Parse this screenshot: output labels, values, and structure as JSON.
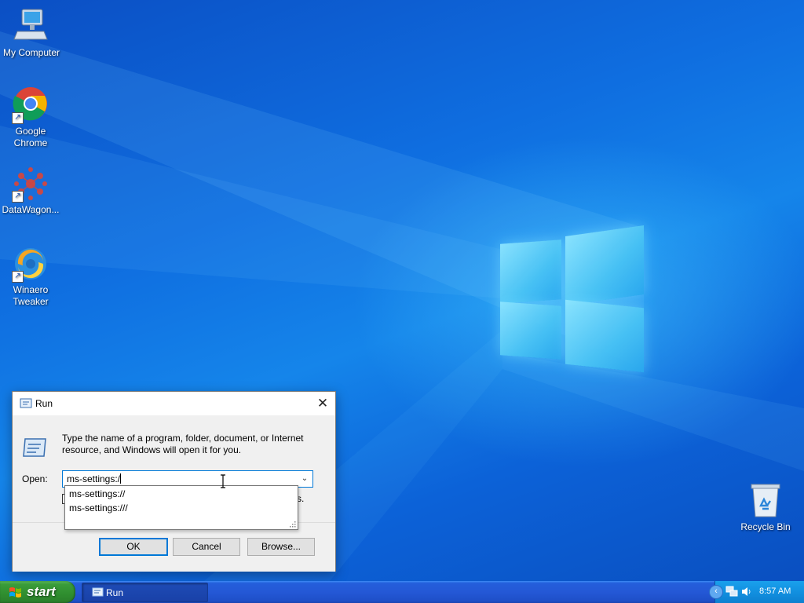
{
  "desktop": {
    "icons": [
      {
        "label": "My Computer",
        "icon": "computer-icon"
      },
      {
        "label": "Google Chrome",
        "icon": "chrome-icon"
      },
      {
        "label": "DataWagon...",
        "icon": "datawagon-icon"
      },
      {
        "label": "Winaero Tweaker",
        "icon": "winaero-icon"
      },
      {
        "label": "Recycle Bin",
        "icon": "recycle-bin-icon"
      }
    ]
  },
  "run_dialog": {
    "title": "Run",
    "description": "Type the name of a program, folder, document, or Internet resource, and Windows will open it for you.",
    "open_label": "Open:",
    "open_value": "ms-settings:/",
    "hidden_tail": "s.",
    "autocomplete": [
      "ms-settings://",
      "ms-settings:///"
    ],
    "buttons": {
      "ok": "OK",
      "cancel": "Cancel",
      "browse": "Browse..."
    }
  },
  "taskbar": {
    "start_label": "start",
    "tasks": [
      {
        "label": "Run",
        "icon": "run-icon"
      }
    ],
    "clock": "8:57 AM"
  },
  "colors": {
    "taskbar": "#245edb",
    "start": "#3a9c3a",
    "accent": "#0078d7"
  }
}
